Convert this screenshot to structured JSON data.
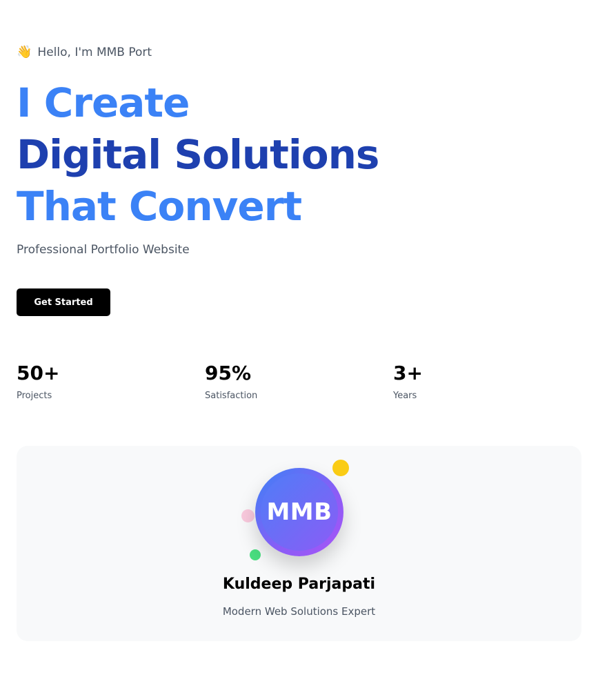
{
  "hero": {
    "greeting_emoji": "👋",
    "greeting": "Hello, I'm MMB Port",
    "headline": [
      "I Create",
      "Digital Solutions",
      "That Convert"
    ],
    "subtitle": "Professional Portfolio Website",
    "cta_label": "Get Started"
  },
  "stats": [
    {
      "value": "50+",
      "label": "Projects"
    },
    {
      "value": "95%",
      "label": "Satisfaction"
    },
    {
      "value": "3+",
      "label": "Years"
    }
  ],
  "profile": {
    "initials": "MMB",
    "name": "Kuldeep Parjapati",
    "role": "Modern Web Solutions Expert"
  },
  "colors": {
    "accent_blue": "#3b82f6",
    "accent_dark_blue": "#1e40af",
    "button_bg": "#000000",
    "card_bg": "#f8f9fa",
    "dot_yellow": "#facc15",
    "dot_pink": "#f9c9dd",
    "dot_green": "#4ade80"
  }
}
